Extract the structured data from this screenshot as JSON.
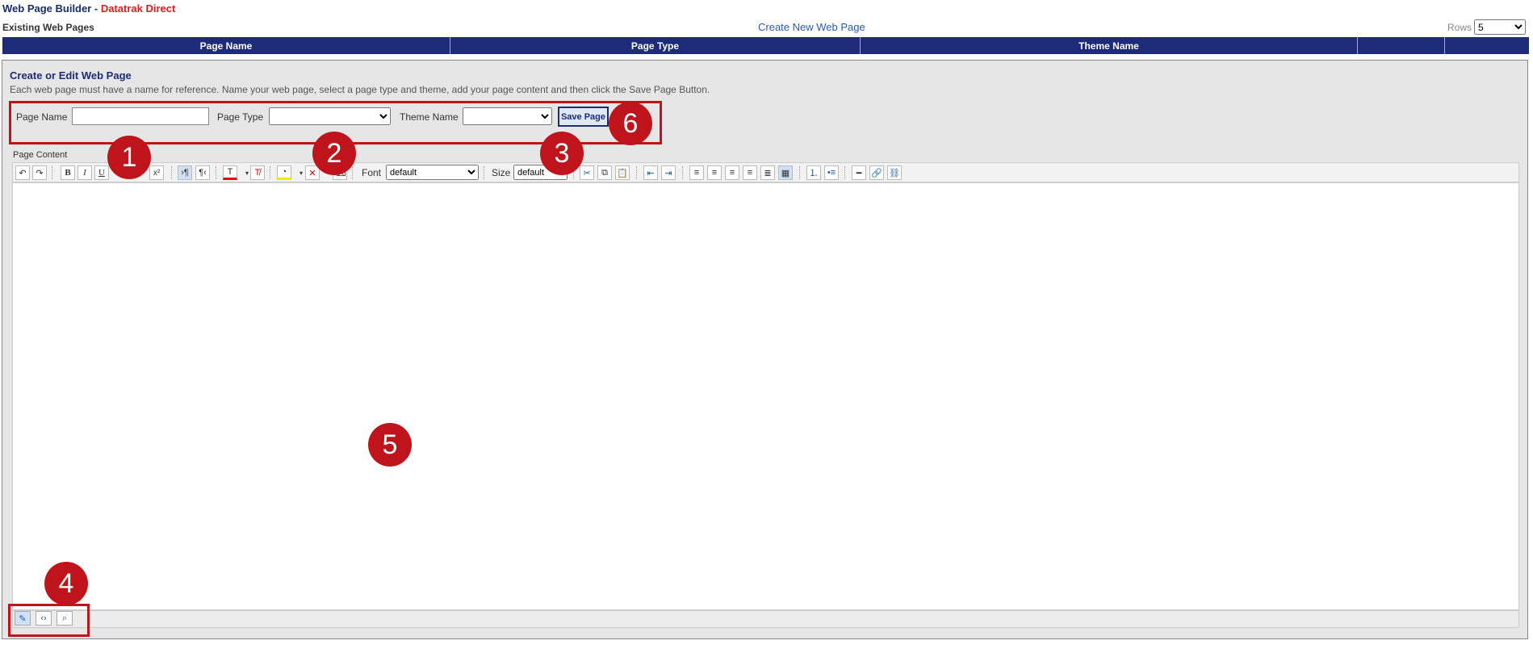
{
  "header": {
    "title": "Web Page Builder - ",
    "brand": "Datatrak Direct",
    "existing_label": "Existing Web Pages",
    "create_link": "Create New Web Page",
    "rows_label": "Rows",
    "rows_value": "5"
  },
  "grid": {
    "columns": [
      "Page Name",
      "Page Type",
      "Theme Name",
      "",
      ""
    ]
  },
  "panel": {
    "title": "Create or Edit Web Page",
    "description": "Each web page must have a name for reference. Name your web page, select a page type and theme, add your page content and then click the Save Page Button.",
    "page_name_label": "Page Name",
    "page_name_value": "",
    "page_type_label": "Page Type",
    "page_type_value": "",
    "theme_label": "Theme Name",
    "theme_value": "",
    "save_label": "Save Page",
    "content_label": "Page Content"
  },
  "toolbar": {
    "font_label": "Font",
    "font_value": "default",
    "size_label": "Size",
    "size_value": "default",
    "bold": "B",
    "italic": "I",
    "underline": "U",
    "superscript": "x²"
  },
  "callouts": [
    "1",
    "2",
    "3",
    "4",
    "5",
    "6"
  ],
  "colors": {
    "header_bg": "#1e2b78",
    "brand_red": "#e21b1b",
    "callout_red": "#c0141c",
    "panel_bg": "#e6e6e6"
  }
}
